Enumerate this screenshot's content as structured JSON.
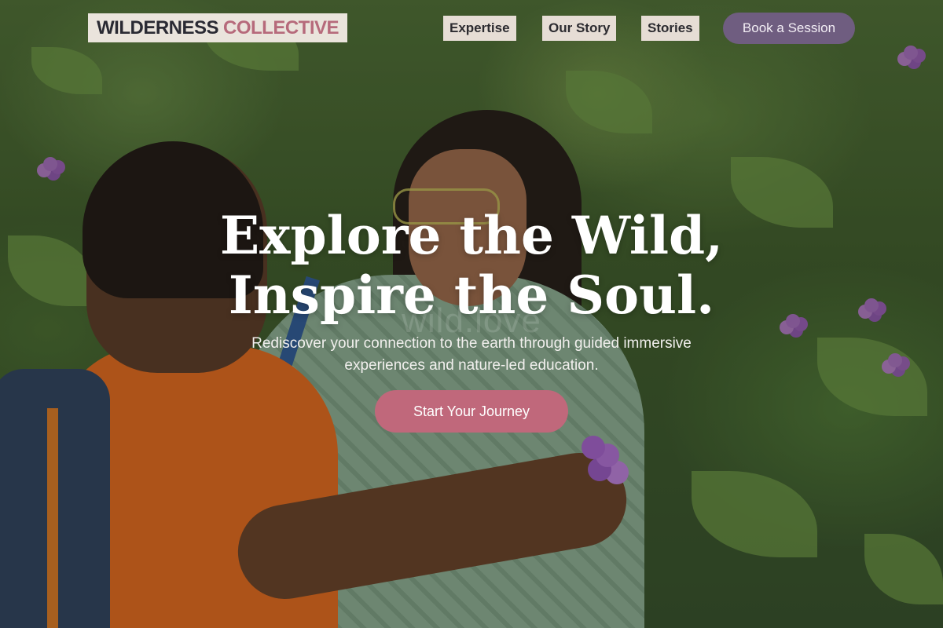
{
  "header": {
    "logo_primary": "WILDERNESS",
    "logo_secondary": "COLLECTIVE",
    "nav": [
      {
        "label": "Expertise"
      },
      {
        "label": "Our Story"
      },
      {
        "label": "Stories"
      }
    ],
    "book_label": "Book a Session"
  },
  "hero": {
    "headline_line1": "Explore the Wild,",
    "headline_line2": "Inspire the Soul.",
    "subtitle_line1": "Rediscover your connection to the earth through guided immersive",
    "subtitle_line2": "experiences and nature-led education.",
    "cta_label": "Start Your Journey",
    "watermark": "wild.love"
  },
  "colors": {
    "brand_dark": "#2a2a33",
    "brand_rose": "#b66a7b",
    "book_button": "#6f5d80",
    "cta_button": "#c0687b"
  }
}
